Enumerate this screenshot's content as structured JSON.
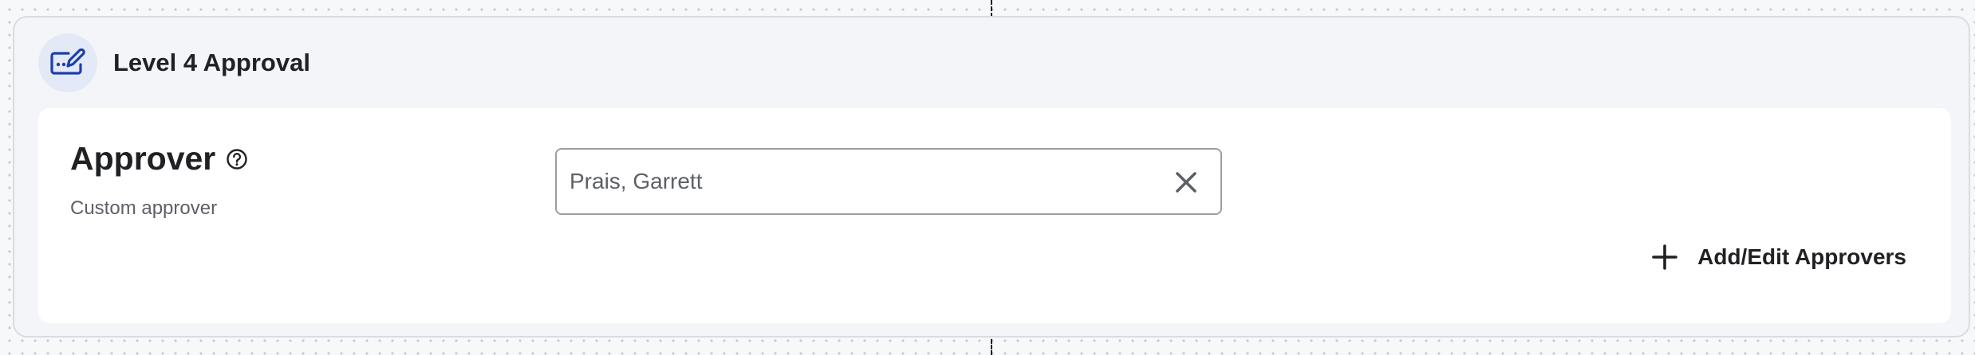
{
  "level_card": {
    "title": "Level 4 Approval",
    "icon": "signature-pen-icon",
    "accent_color": "#1d3fa8",
    "icon_background": "#e4e9f7"
  },
  "approver_field": {
    "label": "Approver",
    "help_icon": "help-circle-icon",
    "subtitle": "Custom approver",
    "value": "Prais, Garrett",
    "clear_icon": "close-icon"
  },
  "actions": {
    "add_edit_label": "Add/Edit Approvers",
    "add_edit_icon": "plus-icon"
  }
}
